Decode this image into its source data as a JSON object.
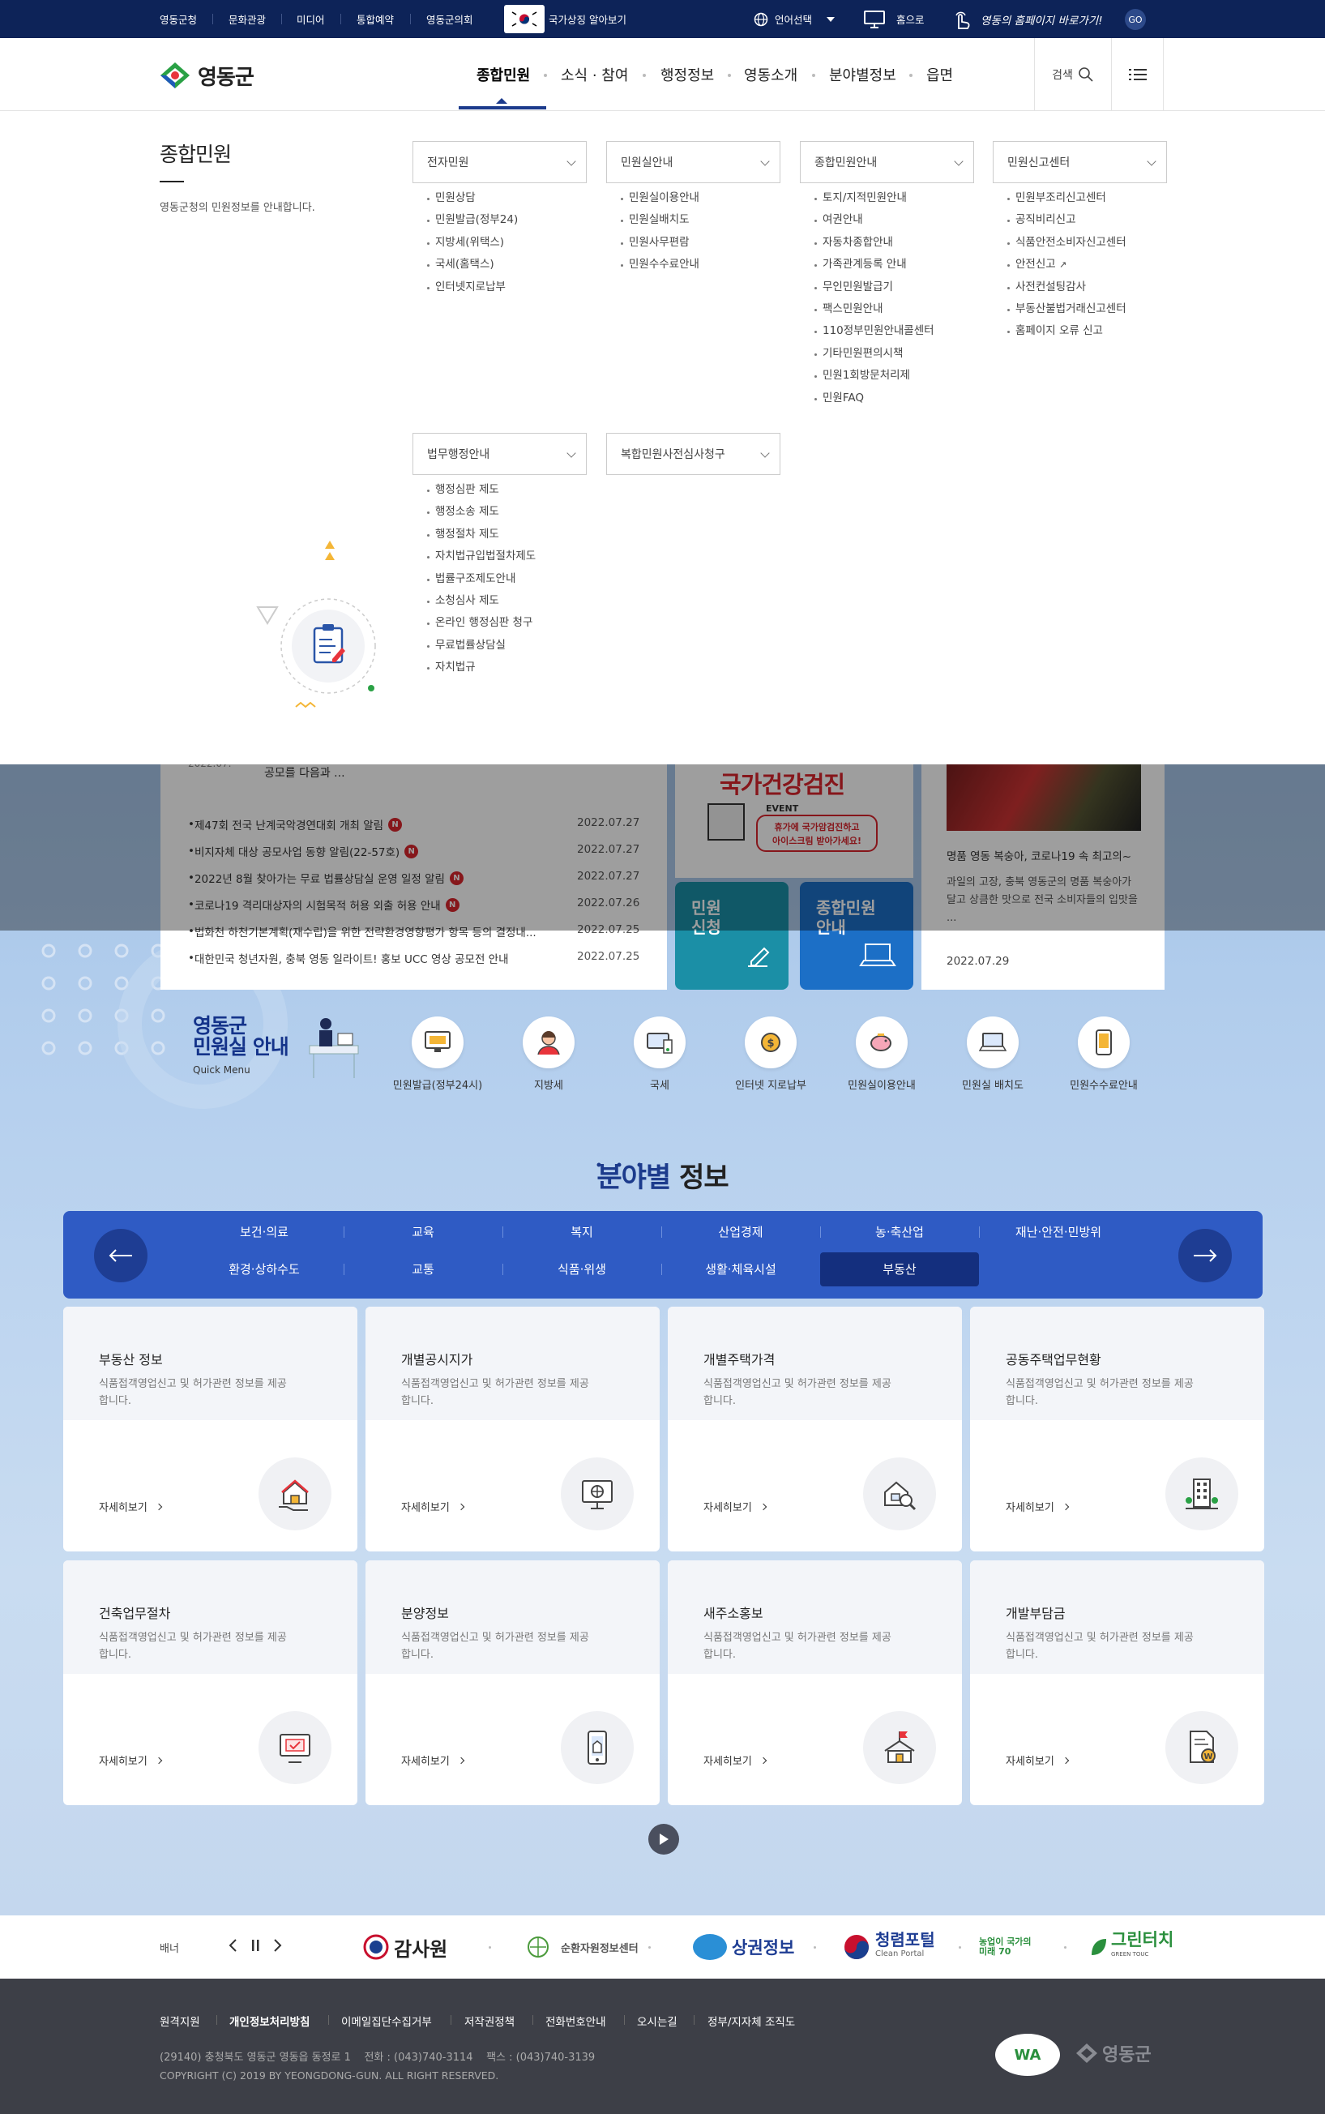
{
  "topbar": {
    "links": [
      "영동군청",
      "문화관광",
      "미디어",
      "통합예약",
      "영동군의회"
    ],
    "national_symbol": "국가상징 알아보기",
    "language": "언어선택",
    "home": "홈으로",
    "yd_home_go": "영동의 홈페이지 바로가기!",
    "go": "GO"
  },
  "header": {
    "logo_text": "영동군",
    "gnb": [
      "종합민원",
      "소식 · 참여",
      "행정정보",
      "영동소개",
      "분야별정보",
      "읍면"
    ],
    "search_label": "검색"
  },
  "mega": {
    "title": "종합민원",
    "desc": "영동군청의 민원정보를 안내합니다.",
    "groups": [
      {
        "title": "전자민원",
        "items": [
          "민원상담",
          "민원발급(정부24)",
          "지방세(위택스)",
          "국세(홈택스)",
          "인터넷지로납부"
        ]
      },
      {
        "title": "민원실안내",
        "items": [
          "민원실이용안내",
          "민원실배치도",
          "민원사무편람",
          "민원수수료안내"
        ]
      },
      {
        "title": "종합민원안내",
        "items": [
          "토지/지적민원안내",
          "여권안내",
          "자동차종합안내",
          "가족관계등록 안내",
          "무인민원발급기",
          "팩스민원안내",
          "110정부민원안내콜센터",
          "기타민원편의시책",
          "민원1회방문처리제",
          "민원FAQ"
        ]
      },
      {
        "title": "민원신고센터",
        "items": [
          "민원부조리신고센터",
          "공직비리신고",
          "식품안전소비자신고센터",
          "안전신고",
          "사전컨설팅감사",
          "부동산불법거래신고센터",
          "홈페이지 오류 신고"
        ]
      },
      {
        "title": "법무행정안내",
        "items": [
          "행정심판 제도",
          "행정소송 제도",
          "행정절차 제도",
          "자치법규입법절차제도",
          "법률구조제도안내",
          "소청심사 제도",
          "온라인 행정심판 청구",
          "무료법률상담실",
          "자치법규"
        ]
      },
      {
        "title": "복합민원사전심사청구",
        "items": []
      }
    ]
  },
  "news": {
    "partial_date": "2022.07.",
    "partial_text": "공모를 다음과 ...",
    "rows": [
      {
        "title": "제47회 전국 난계국악경연대회 개최 알림",
        "date": "2022.07.27",
        "new": "N"
      },
      {
        "title": "비지자체 대상 공모사업 동향 알림(22-57호)",
        "date": "2022.07.27",
        "new": "N"
      },
      {
        "title": "2022년 8월 찾아가는 무료 법률상담실 운영 일정 알림",
        "date": "2022.07.27",
        "new": "N"
      },
      {
        "title": "코로나19 격리대상자의 시험목적 허용 외출 허용 안내",
        "date": "2022.07.26",
        "new": "N"
      },
      {
        "title": "법화천 하천기본계획(재수립)을 위한 전략환경영향평가 항목 등의 결정내...",
        "date": "2022.07.25",
        "new": ""
      },
      {
        "title": "대한민국 청년자원, 충북 영동 일라이트! 홍보 UCC 영상 공모전 안내",
        "date": "2022.07.25",
        "new": ""
      }
    ]
  },
  "checkup": {
    "title": "국가건강검진",
    "event": "EVENT",
    "line1": "휴가에 국가암검진하고",
    "line2": "아이스크림 받아가세요!"
  },
  "quick_buttons": {
    "apply": "민원\n신청",
    "guide": "종합민원\n안내"
  },
  "photo_news": {
    "title": "명품 영동 복숭아, 코로나19 속 최고의~",
    "body": "과일의 고장, 충북 영동군의 명품 복숭아가 달고 상큼한 맛으로 전국 소비자들의 입맛을 ...",
    "date": "2022.07.29"
  },
  "quick_menu": {
    "title": "영동군\n민원실 안내",
    "sub": "Quick Menu",
    "items": [
      {
        "label": "민원발급(정부24시)",
        "icon": "monitor-icon"
      },
      {
        "label": "지방세",
        "icon": "person-icon"
      },
      {
        "label": "국세",
        "icon": "computer-icon"
      },
      {
        "label": "인터넷 지로납부",
        "icon": "coin-icon"
      },
      {
        "label": "민원실이용안내",
        "icon": "piggy-bank-icon"
      },
      {
        "label": "민원실 배치도",
        "icon": "laptop-icon"
      },
      {
        "label": "민원수수료안내",
        "icon": "phone-icon"
      }
    ]
  },
  "field": {
    "title_bold": "분야별",
    "title_rest": "정보",
    "tabs_row1": [
      "보건·의료",
      "교육",
      "복지",
      "산업경제",
      "농·축산업",
      "재난·안전·민방위"
    ],
    "tabs_row2": [
      "환경·상하수도",
      "교통",
      "식품·위생",
      "생활·체육시설",
      "부동산"
    ],
    "active_tab": "부동산",
    "more": "자세히보기",
    "desc": "식품접객영업신고 및 허가관련 정보를 제공합니다.",
    "cards": [
      {
        "title": "부동산 정보",
        "icon": "house-hand-icon"
      },
      {
        "title": "개별공시지가",
        "icon": "map-screen-icon"
      },
      {
        "title": "개별주택가격",
        "icon": "house-search-icon"
      },
      {
        "title": "공동주택업무현황",
        "icon": "apartment-icon"
      },
      {
        "title": "건축업무절차",
        "icon": "computer-check-icon"
      },
      {
        "title": "분양정보",
        "icon": "phone-building-icon"
      },
      {
        "title": "새주소홍보",
        "icon": "address-building-icon"
      },
      {
        "title": "개발부담금",
        "icon": "document-money-icon"
      }
    ]
  },
  "banner": {
    "label": "배너",
    "logos": [
      "감사원",
      "순환자원정보센터",
      "상권정보",
      "청렴포털",
      "농업이 국가의 미래 70",
      "그린터치"
    ],
    "clean_sub": "Clean Portal",
    "green_sub": "GREEN TOUC"
  },
  "footer": {
    "links": [
      "원격지원",
      "개인정보처리방침",
      "이메일집단수집거부",
      "저작권정책",
      "전화번호안내",
      "오시는길",
      "정부/지자체 조직도"
    ],
    "address": "(29140) 충청북도 영동군 영동읍 동정로 1    전화 : (043)740-3114    팩스 : (043)740-3139",
    "copyright": "COPYRIGHT (C) 2019 BY YEONGDONG-GUN. ALL RIGHT RESERVED.",
    "wa_mark": "WA",
    "logo_text": "영동군"
  },
  "colors": {
    "navy": "#0d2358",
    "field_blue": "#2f5bc4",
    "active_tab": "#142f7e",
    "teal_btn": "#1b8fa6",
    "blue_btn": "#1c6fc6",
    "new_badge": "#d8262d"
  }
}
